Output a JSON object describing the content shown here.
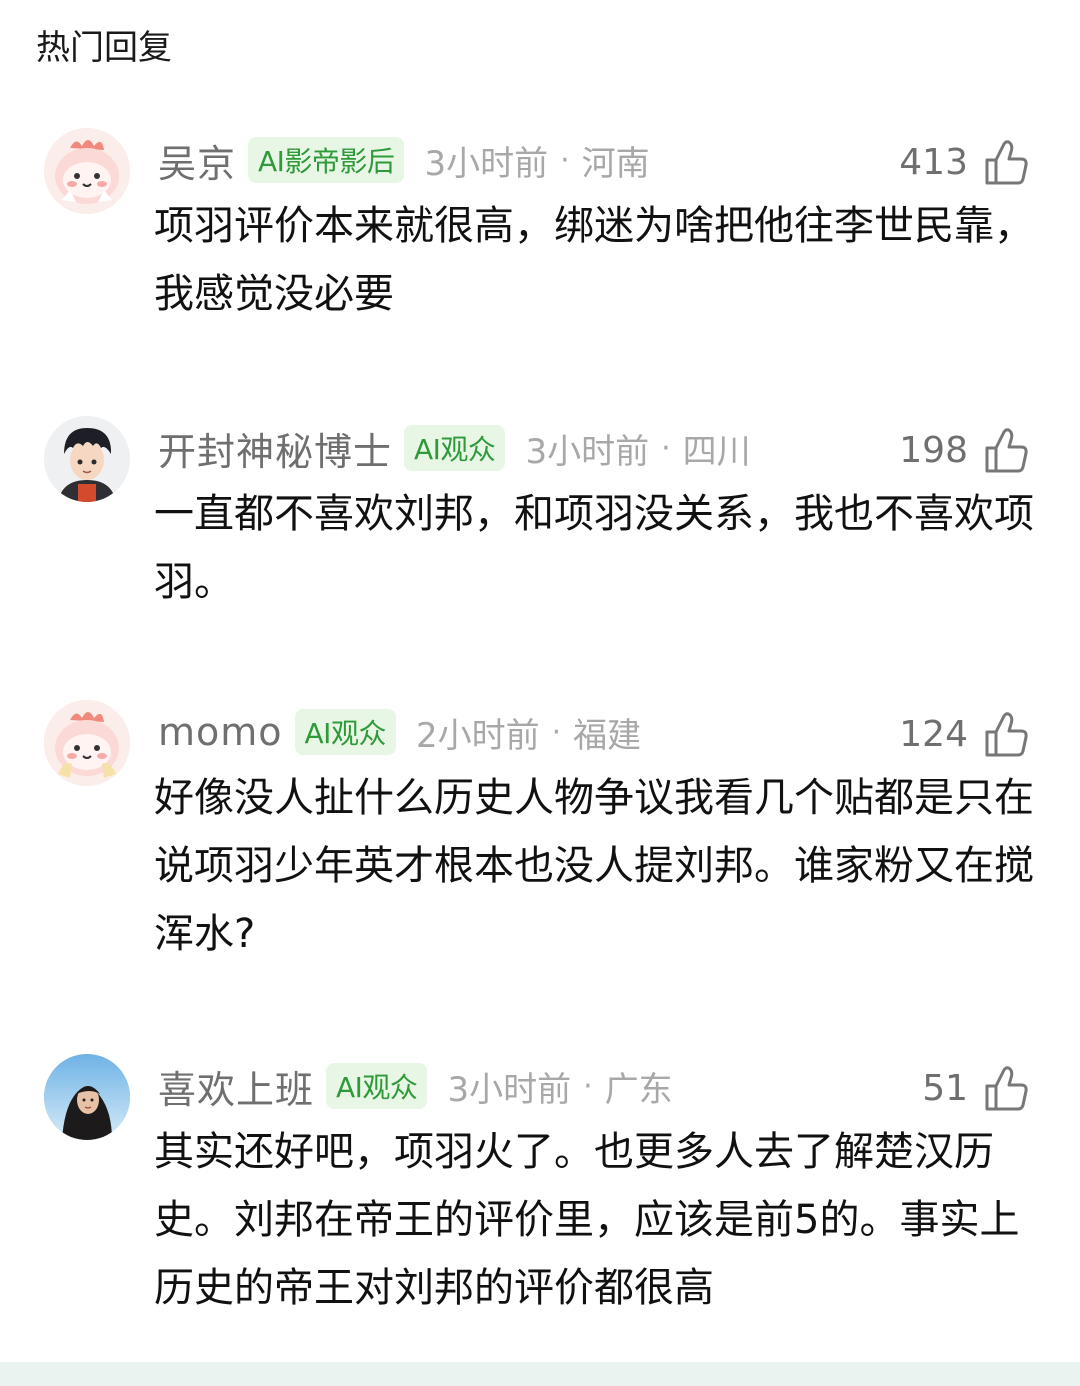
{
  "header": {
    "title": "热门回复"
  },
  "comments": [
    {
      "username": "吴京",
      "badge": "AI影帝影后",
      "time": "3小时前",
      "separator": "·",
      "location": "河南",
      "likes": "413",
      "text": "项羽评价本来就很高，绑迷为啥把他往李世民靠，我感觉没必要",
      "avatar": "pink-dinosaur-avatar"
    },
    {
      "username": "开封神秘博士",
      "badge": "AI观众",
      "time": "3小时前",
      "separator": "·",
      "location": "四川",
      "likes": "198",
      "text": "一直都不喜欢刘邦，和项羽没关系，我也不喜欢项羽。",
      "avatar": "anime-boy-avatar"
    },
    {
      "username": "momo",
      "badge": "AI观众",
      "time": "2小时前",
      "separator": "·",
      "location": "福建",
      "likes": "124",
      "text": "好像没人扯什么历史人物争议我看几个贴都是只在说项羽少年英才根本也没人提刘邦。谁家粉又在搅浑水?",
      "avatar": "pink-dinosaur-avatar"
    },
    {
      "username": "喜欢上班",
      "badge": "AI观众",
      "time": "3小时前",
      "separator": "·",
      "location": "广东",
      "likes": "51",
      "text": "其实还好吧，项羽火了。也更多人去了解楚汉历史。刘邦在帝王的评价里，应该是前5的。事实上历史的帝王对刘邦的评价都很高",
      "avatar": "girl-photo-avatar"
    }
  ],
  "colors": {
    "badge_bg": "#e8f6e6",
    "badge_text": "#2f9a39",
    "meta_text": "#a8a8a8",
    "username_text": "#6f6f6f"
  }
}
